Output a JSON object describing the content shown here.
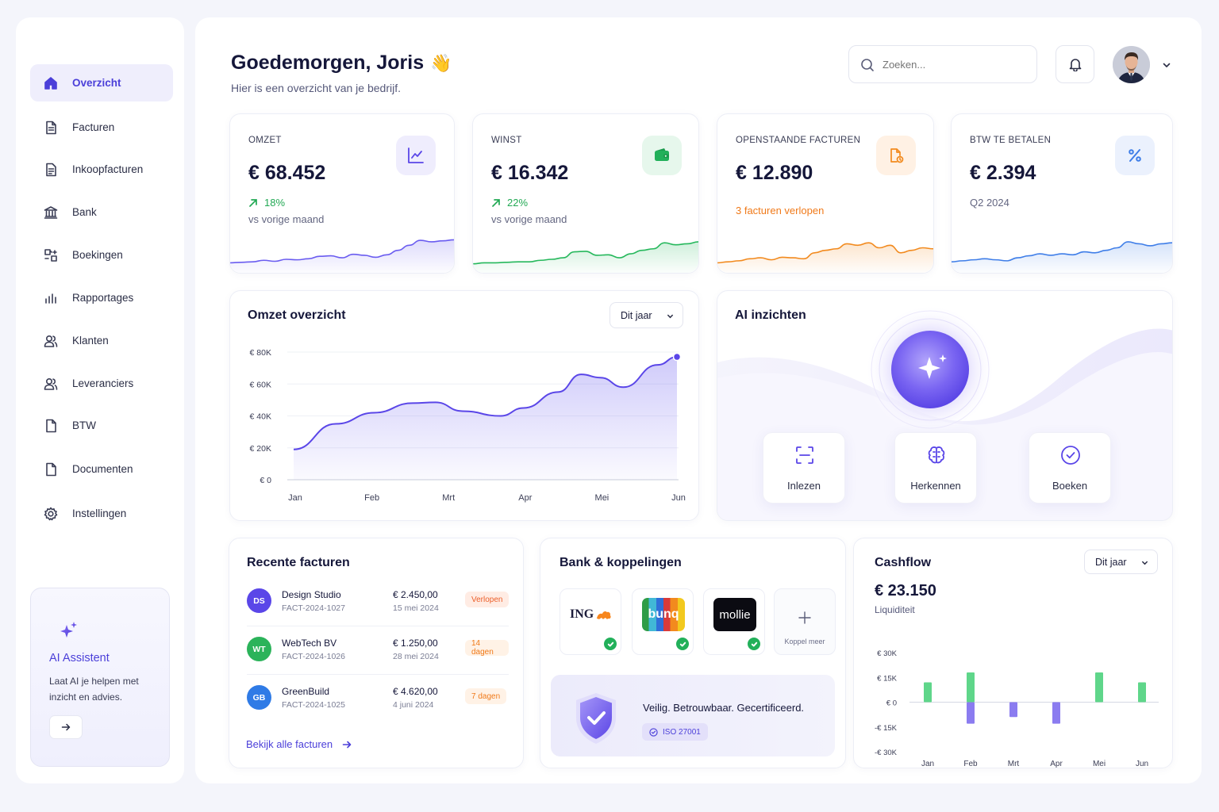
{
  "sidebar": {
    "items": [
      {
        "label": "Overzicht",
        "icon": "home-icon",
        "active": true
      },
      {
        "label": "Facturen",
        "icon": "invoice-icon"
      },
      {
        "label": "Inkoopfacturen",
        "icon": "purchase-invoice-icon"
      },
      {
        "label": "Bank",
        "icon": "bank-icon"
      },
      {
        "label": "Boekingen",
        "icon": "bookings-icon"
      },
      {
        "label": "Rapportages",
        "icon": "reports-icon"
      },
      {
        "label": "Klanten",
        "icon": "customers-icon"
      },
      {
        "label": "Leveranciers",
        "icon": "suppliers-icon"
      },
      {
        "label": "BTW",
        "icon": "vat-icon"
      },
      {
        "label": "Documenten",
        "icon": "documents-icon"
      },
      {
        "label": "Instellingen",
        "icon": "settings-icon"
      }
    ],
    "ai_card": {
      "title": "AI Assistent",
      "text_line1": "Laat AI je helpen met",
      "text_line2": "inzicht en advies.",
      "icon": "sparkle-icon",
      "button_icon": "arrow-right-icon"
    }
  },
  "header": {
    "greeting": "Goedemorgen, Joris",
    "wave": "👋",
    "subtitle": "Hier is een overzicht van je bedrijf.",
    "search_placeholder": "Zoeken...",
    "icons": [
      "search-icon",
      "bell-icon",
      "avatar",
      "chevron-down-icon"
    ]
  },
  "kpis": [
    {
      "label": "OMZET",
      "value": "€ 68.452",
      "change": "18%",
      "sub": "vs vorige maand",
      "icon": "trend-chart-icon",
      "color": "#6a5cf0",
      "icon_bg": "#efedfd",
      "spark": [
        0.2,
        0.21,
        0.22,
        0.25,
        0.23,
        0.27,
        0.26,
        0.28,
        0.33,
        0.34,
        0.3,
        0.37,
        0.35,
        0.31,
        0.36,
        0.45,
        0.55,
        0.65,
        0.62,
        0.64,
        0.66
      ]
    },
    {
      "label": "WINST",
      "value": "€ 16.342",
      "change": "22%",
      "sub": "vs vorige maand",
      "icon": "wallet-icon",
      "color": "#26b85c",
      "icon_bg": "#e6f7ec",
      "spark": [
        0.18,
        0.2,
        0.2,
        0.21,
        0.22,
        0.22,
        0.25,
        0.27,
        0.3,
        0.42,
        0.43,
        0.35,
        0.36,
        0.3,
        0.38,
        0.45,
        0.48,
        0.6,
        0.56,
        0.58,
        0.62
      ]
    },
    {
      "label": "OPENSTAANDE FACTUREN",
      "value": "€ 12.890",
      "note": "3 facturen verlopen",
      "icon": "document-alert-icon",
      "color": "#f28a1e",
      "icon_bg": "#fff1e4",
      "spark": [
        0.2,
        0.22,
        0.24,
        0.28,
        0.3,
        0.26,
        0.31,
        0.3,
        0.28,
        0.4,
        0.45,
        0.48,
        0.58,
        0.55,
        0.6,
        0.5,
        0.55,
        0.4,
        0.45,
        0.5,
        0.48
      ]
    },
    {
      "label": "BTW TE BETALEN",
      "value": "€ 2.394",
      "note": "Q2 2024",
      "icon": "percent-icon",
      "color": "#3f7ee8",
      "icon_bg": "#ebf1fd",
      "spark": [
        0.22,
        0.24,
        0.26,
        0.28,
        0.26,
        0.24,
        0.3,
        0.34,
        0.38,
        0.35,
        0.38,
        0.36,
        0.42,
        0.4,
        0.45,
        0.5,
        0.62,
        0.58,
        0.54,
        0.58,
        0.6
      ]
    }
  ],
  "revenue_overview": {
    "title": "Omzet overzicht",
    "period": "Dit jaar"
  },
  "chart_data": [
    {
      "type": "area",
      "title": "Omzet overzicht",
      "categories": [
        "Jan",
        "Feb",
        "Mrt",
        "Apr",
        "Mei",
        "Jun"
      ],
      "yticks": [
        "€ 80K",
        "€ 60K",
        "€ 40K",
        "€ 20K",
        "€ 0"
      ],
      "ylim": [
        0,
        80000
      ],
      "x": [
        0,
        0.6,
        1.0,
        1.5,
        1.75,
        2.1,
        2.6,
        3.0,
        3.5,
        3.75,
        4.1,
        4.6,
        5.0
      ],
      "y": [
        19000,
        35000,
        42000,
        48000,
        48500,
        43000,
        40000,
        45000,
        55000,
        66000,
        64000,
        58000,
        72000,
        77000
      ],
      "color": "#5a46e8"
    },
    {
      "type": "bar",
      "title": "Cashflow",
      "categories": [
        "Jan",
        "Feb",
        "Mrt",
        "Apr",
        "Mei",
        "Jun"
      ],
      "yticks": [
        "€ 30K",
        "€ 15K",
        "€ 0",
        "-€ 15K",
        "-€ 30K"
      ],
      "ylim": [
        -30000,
        30000
      ],
      "series": [
        {
          "values": [
            12000,
            18000,
            0,
            0,
            18000,
            12000
          ],
          "color": "#5fd68a"
        },
        {
          "values": [
            0,
            -13000,
            -9000,
            -13000,
            0,
            0
          ],
          "color": "#8b7cf0"
        }
      ]
    }
  ],
  "ai_insights": {
    "title": "AI inzichten",
    "actions": [
      {
        "label": "Inlezen",
        "icon": "scan-icon"
      },
      {
        "label": "Herkennen",
        "icon": "brain-icon"
      },
      {
        "label": "Boeken",
        "icon": "check-circle-icon"
      }
    ]
  },
  "recent_invoices": {
    "title": "Recente facturen",
    "rows": [
      {
        "initials": "DS",
        "name": "Design Studio",
        "number": "FACT-2024-1027",
        "amount": "€ 2.450,00",
        "date": "15 mei 2024",
        "status": "Verlopen",
        "avatar_color": "#5a46e8"
      },
      {
        "initials": "WT",
        "name": "WebTech BV",
        "number": "FACT-2024-1026",
        "amount": "€ 1.250,00",
        "date": "28 mei 2024",
        "status": "14 dagen",
        "avatar_color": "#2bb35a"
      },
      {
        "initials": "GB",
        "name": "GreenBuild",
        "number": "FACT-2024-1025",
        "amount": "€ 4.620,00",
        "date": "4 juni 2024",
        "status": "7 dagen",
        "avatar_color": "#2f7be6"
      }
    ],
    "link": "Bekijk alle facturen"
  },
  "bank": {
    "title": "Bank & koppelingen",
    "banks": [
      {
        "name": "ING",
        "logo": "ing-lion-icon"
      },
      {
        "name": "bunq"
      },
      {
        "name": "mollie"
      }
    ],
    "add_label": "Koppel meer",
    "security_text": "Veilig. Betrouwbaar. Gecertificeerd.",
    "iso": "ISO 27001",
    "shield_icon": "shield-check-icon"
  },
  "cashflow": {
    "title": "Cashflow",
    "period": "Dit jaar",
    "value": "€ 23.150",
    "label": "Liquiditeit"
  }
}
